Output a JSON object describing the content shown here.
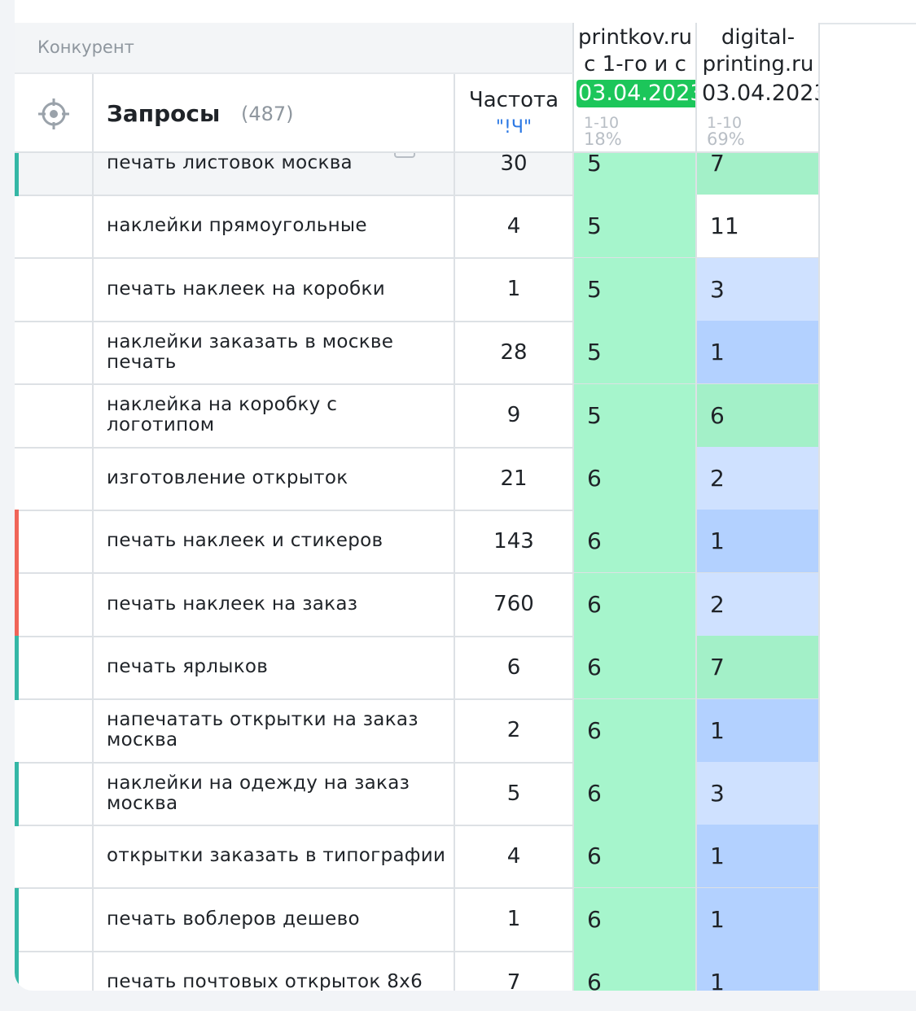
{
  "header": {
    "competitor_label": "Конкурент",
    "queries_title": "Запросы",
    "queries_count": "(487)",
    "frequency_title": "Частота",
    "frequency_mode": "\"!Ч\""
  },
  "competitors": [
    {
      "name": "printkov.ru\nс 1-го и с",
      "date": "03.04.2023",
      "date_highlight": true,
      "range": "1-10",
      "percent": "18%"
    },
    {
      "name": "digital-\nprinting.ru",
      "date": "03.04.2023",
      "date_highlight": false,
      "range": "1-10",
      "percent": "69%"
    }
  ],
  "colors": {
    "green_strong": "#a6f5cc",
    "green": "#a3f0c8",
    "blue_light": "#cfe1ff",
    "blue": "#b3d1ff",
    "white": "#ffffff",
    "marker_teal": "#35b7a6",
    "marker_red": "#f06458",
    "date_green": "#1cc65a"
  },
  "rows": [
    {
      "query": "печать листовок москва",
      "freq": "30",
      "p1": "5",
      "p2": "7",
      "marker": "teal",
      "hover": true
    },
    {
      "query": "наклейки прямоугольные",
      "freq": "4",
      "p1": "5",
      "p2": "11",
      "marker": "none"
    },
    {
      "query": "печать наклеек на коробки",
      "freq": "1",
      "p1": "5",
      "p2": "3",
      "marker": "none"
    },
    {
      "query": "наклейки заказать в москве печать",
      "freq": "28",
      "p1": "5",
      "p2": "1",
      "marker": "none"
    },
    {
      "query": "наклейка на коробку с логотипом",
      "freq": "9",
      "p1": "5",
      "p2": "6",
      "marker": "none"
    },
    {
      "query": "изготовление открыток",
      "freq": "21",
      "p1": "6",
      "p2": "2",
      "marker": "none"
    },
    {
      "query": "печать наклеек и стикеров",
      "freq": "143",
      "p1": "6",
      "p2": "1",
      "marker": "red"
    },
    {
      "query": "печать наклеек на заказ",
      "freq": "760",
      "p1": "6",
      "p2": "2",
      "marker": "red"
    },
    {
      "query": "печать ярлыков",
      "freq": "6",
      "p1": "6",
      "p2": "7",
      "marker": "teal"
    },
    {
      "query": "напечатать открытки на заказ москва",
      "freq": "2",
      "p1": "6",
      "p2": "1",
      "marker": "none"
    },
    {
      "query": "наклейки на одежду на заказ москва",
      "freq": "5",
      "p1": "6",
      "p2": "3",
      "marker": "teal"
    },
    {
      "query": "открытки заказать в типографии",
      "freq": "4",
      "p1": "6",
      "p2": "1",
      "marker": "none"
    },
    {
      "query": "печать воблеров дешево",
      "freq": "1",
      "p1": "6",
      "p2": "1",
      "marker": "teal"
    },
    {
      "query": "печать почтовых открыток 8х6",
      "freq": "7",
      "p1": "6",
      "p2": "1",
      "marker": "teal"
    }
  ]
}
